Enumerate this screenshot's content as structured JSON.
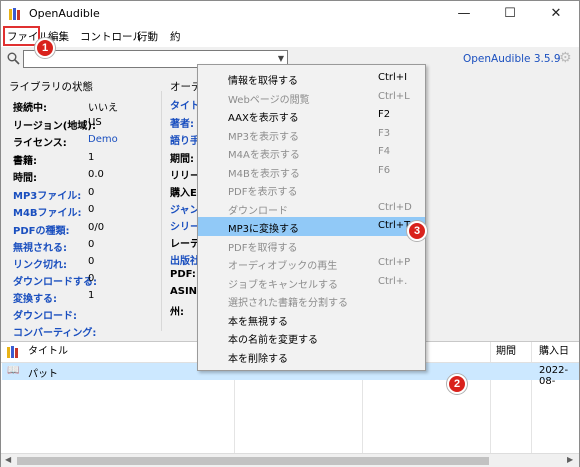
{
  "window": {
    "title": "OpenAudible",
    "minimize_glyph": "—",
    "maximize_glyph": "☐",
    "close_glyph": "✕"
  },
  "menubar": [
    "ファイル",
    "編集",
    "コントロール",
    "行動",
    "約"
  ],
  "toolbar": {
    "search_placeholder": "",
    "brand": "OpenAudible 3.5.9"
  },
  "markers": {
    "m1": "1",
    "m2": "2",
    "m3": "3"
  },
  "colors": {
    "link": "#1a4fbf",
    "highlight": "#91c9f7",
    "marker": "#d9221c",
    "row_selected": "#cce8ff"
  },
  "library": {
    "title": "ライブラリの状態",
    "rows": [
      {
        "label": "接続中:",
        "value": "いいえ",
        "link": false
      },
      {
        "label": "リージョン(地域):",
        "value": "US",
        "link": false
      },
      {
        "label": "ライセンス:",
        "value": "Demo",
        "link": false,
        "value_link": true
      },
      {
        "label": "書籍:",
        "value": "1",
        "link": false
      },
      {
        "label": "時間:",
        "value": "0.0",
        "link": false
      },
      {
        "label": "MP3ファイル:",
        "value": "0",
        "link": true
      },
      {
        "label": "M4Bファイル:",
        "value": "0",
        "link": true
      },
      {
        "label": "PDFの種類:",
        "value": "0/0",
        "link": true
      },
      {
        "label": "無視される:",
        "value": "0",
        "link": true
      },
      {
        "label": "リンク切れ:",
        "value": "0",
        "link": true
      },
      {
        "label": "ダウンロードする:",
        "value": "0",
        "link": true
      },
      {
        "label": "変換する:",
        "value": "1",
        "link": true
      },
      {
        "label": "ダウンロード:",
        "value": "",
        "link": true
      },
      {
        "label": "コンバーティング:",
        "value": "",
        "link": true
      }
    ]
  },
  "audiobook": {
    "title": "オーディ",
    "rows": [
      {
        "label": "タイトル",
        "link": true
      },
      {
        "label": "著者:",
        "link": true
      },
      {
        "label": "語り手",
        "link": true
      },
      {
        "label": "期間:",
        "link": false
      },
      {
        "label": "リリース",
        "link": false
      },
      {
        "label": "購入E",
        "link": false
      },
      {
        "label": "ジャンル",
        "link": true
      },
      {
        "label": "シリーズ",
        "link": true
      },
      {
        "label": "レーティ",
        "link": false
      },
      {
        "label": "出版社",
        "link": true
      },
      {
        "label": "PDF:",
        "link": false
      },
      {
        "label": "ASIN",
        "link": false
      },
      {
        "label": "州:",
        "link": false
      }
    ]
  },
  "dropdown": [
    {
      "label": "情報を取得する",
      "shortcut": "Ctrl+I",
      "enabled": true,
      "selected": false
    },
    {
      "label": "Webページの閲覧",
      "shortcut": "Ctrl+L",
      "enabled": false,
      "selected": false
    },
    {
      "label": "AAXを表示する",
      "shortcut": "F2",
      "enabled": true,
      "selected": false
    },
    {
      "label": "MP3を表示する",
      "shortcut": "F3",
      "enabled": false,
      "selected": false
    },
    {
      "label": "M4Aを表示する",
      "shortcut": "F4",
      "enabled": false,
      "selected": false
    },
    {
      "label": "M4Bを表示する",
      "shortcut": "F6",
      "enabled": false,
      "selected": false
    },
    {
      "label": "PDFを表示する",
      "shortcut": "",
      "enabled": false,
      "selected": false
    },
    {
      "label": "ダウンロード",
      "shortcut": "Ctrl+D",
      "enabled": false,
      "selected": false
    },
    {
      "label": "MP3に変換する",
      "shortcut": "Ctrl+T",
      "enabled": true,
      "selected": true
    },
    {
      "label": "PDFを取得する",
      "shortcut": "",
      "enabled": false,
      "selected": false
    },
    {
      "label": "オーディオブックの再生",
      "shortcut": "Ctrl+P",
      "enabled": false,
      "selected": false
    },
    {
      "label": "ジョブをキャンセルする",
      "shortcut": "Ctrl+.",
      "enabled": false,
      "selected": false
    },
    {
      "label": "選択された書籍を分割する",
      "shortcut": "",
      "enabled": false,
      "selected": false
    },
    {
      "label": "本を無視する",
      "shortcut": "",
      "enabled": true,
      "selected": false
    },
    {
      "label": "本の名前を変更する",
      "shortcut": "",
      "enabled": true,
      "selected": false
    },
    {
      "label": "本を削除する",
      "shortcut": "",
      "enabled": true,
      "selected": false
    }
  ],
  "list": {
    "columns": {
      "title": "タイトル",
      "duration": "期間",
      "purchased": "購入日"
    },
    "rows": [
      {
        "title": "パット",
        "duration": "",
        "purchased": "2022-08-"
      }
    ]
  }
}
